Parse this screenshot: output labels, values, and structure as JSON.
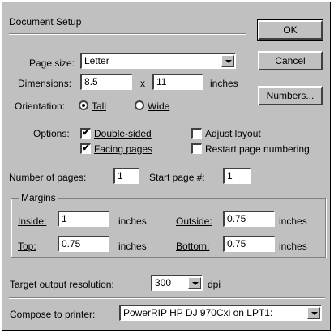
{
  "title": "Document Setup",
  "buttons": {
    "ok": "OK",
    "cancel": "Cancel",
    "numbers": "Numbers..."
  },
  "page_size": {
    "label": "Page size:",
    "value": "Letter"
  },
  "dimensions": {
    "label": "Dimensions:",
    "width": "8.5",
    "x": "x",
    "height": "11",
    "unit": "inches"
  },
  "orientation": {
    "label": "Orientation:",
    "tall": "Tall",
    "wide": "Wide",
    "selected": "Tall"
  },
  "options": {
    "label": "Options:",
    "double_sided": {
      "label": "Double-sided",
      "checked": true
    },
    "facing_pages": {
      "label": "Facing pages",
      "checked": true
    },
    "adjust_layout": {
      "label": "Adjust layout",
      "checked": false
    },
    "restart_numbering": {
      "label": "Restart page numbering",
      "checked": false
    }
  },
  "pages": {
    "count_label": "Number of pages:",
    "count": "1",
    "start_label": "Start page #:",
    "start": "1"
  },
  "margins": {
    "label": "Margins",
    "inside_label": "Inside:",
    "inside": "1",
    "outside_label": "Outside:",
    "outside": "0.75",
    "top_label": "Top:",
    "top": "0.75",
    "bottom_label": "Bottom:",
    "bottom": "0.75",
    "unit": "inches"
  },
  "resolution": {
    "label": "Target output resolution:",
    "value": "300",
    "unit": "dpi"
  },
  "printer": {
    "label": "Compose to printer:",
    "value": "PowerRIP HP DJ 970Cxi on LPT1:"
  },
  "check_mark": "✔"
}
